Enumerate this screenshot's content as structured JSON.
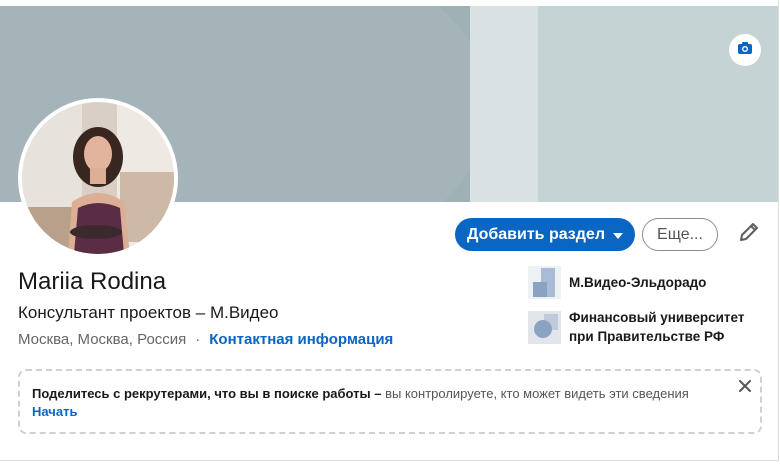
{
  "profile": {
    "name": "Mariia Rodina",
    "headline": "Консультант проектов – М.Видео",
    "location": "Москва, Москва, Россия",
    "separator": "·",
    "contact_link": "Контактная информация"
  },
  "actions": {
    "add_section_label": "Добавить раздел",
    "more_label": "Еще..."
  },
  "organizations": [
    {
      "name": "М.Видео-Эльдорадо",
      "icon": "company-logo-icon"
    },
    {
      "name": "Финансовый университет при Правительстве РФ",
      "icon": "school-logo-icon"
    }
  ],
  "notice": {
    "bold_text": "Поделитесь с рекрутерами, что вы в поиске работы –",
    "text": " вы контролируете, кто может видеть эти сведения",
    "start_link": "Начать"
  },
  "colors": {
    "accent": "#0a66c2",
    "banner": "#9fb1b5",
    "text_primary": "#191919",
    "text_secondary": "#666666"
  }
}
